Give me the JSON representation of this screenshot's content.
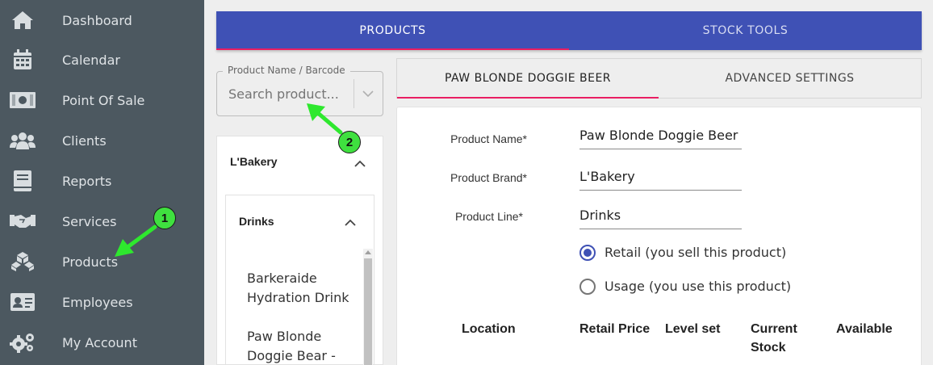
{
  "sidebar": {
    "items": [
      {
        "label": "Dashboard",
        "icon": "home-icon"
      },
      {
        "label": "Calendar",
        "icon": "calendar-icon"
      },
      {
        "label": "Point Of Sale",
        "icon": "cash-icon"
      },
      {
        "label": "Clients",
        "icon": "users-icon"
      },
      {
        "label": "Reports",
        "icon": "book-icon"
      },
      {
        "label": "Services",
        "icon": "handshake-icon"
      },
      {
        "label": "Products",
        "icon": "boxes-icon"
      },
      {
        "label": "Employees",
        "icon": "id-card-icon"
      },
      {
        "label": "My Account",
        "icon": "gears-icon"
      }
    ]
  },
  "topbar": {
    "tabs": [
      {
        "label": "PRODUCTS",
        "active": true
      },
      {
        "label": "STOCK TOOLS",
        "active": false
      }
    ]
  },
  "search": {
    "label": "Product Name / Barcode",
    "placeholder": "Search product..."
  },
  "tree": {
    "brand": "L'Bakery",
    "line": "Drinks",
    "products": [
      "Barkeraide Hydration Drink",
      "Paw Blonde Doggie Bear -"
    ]
  },
  "detail": {
    "tabs": [
      {
        "label": "PAW BLONDE DOGGIE BEER",
        "active": true
      },
      {
        "label": "ADVANCED SETTINGS",
        "active": false
      }
    ],
    "fields": [
      {
        "label": "Product Name*",
        "value": "Paw Blonde Doggie Beer"
      },
      {
        "label": "Product Brand*",
        "value": "L'Bakery"
      },
      {
        "label": "Product Line*",
        "value": "Drinks"
      }
    ],
    "usage_options": [
      {
        "label": "Retail (you sell this product)",
        "checked": true
      },
      {
        "label": "Usage (you use this product)",
        "checked": false
      }
    ],
    "table_headers": [
      "Location",
      "Retail Price",
      "Level set",
      "Current Stock",
      "Available"
    ]
  },
  "annotations": {
    "step1": "1",
    "step2": "2"
  },
  "colors": {
    "sidebar_bg": "#4c5860",
    "primary": "#3f51b5",
    "accent": "#e91e63",
    "annotation_green": "#3fe03f"
  }
}
